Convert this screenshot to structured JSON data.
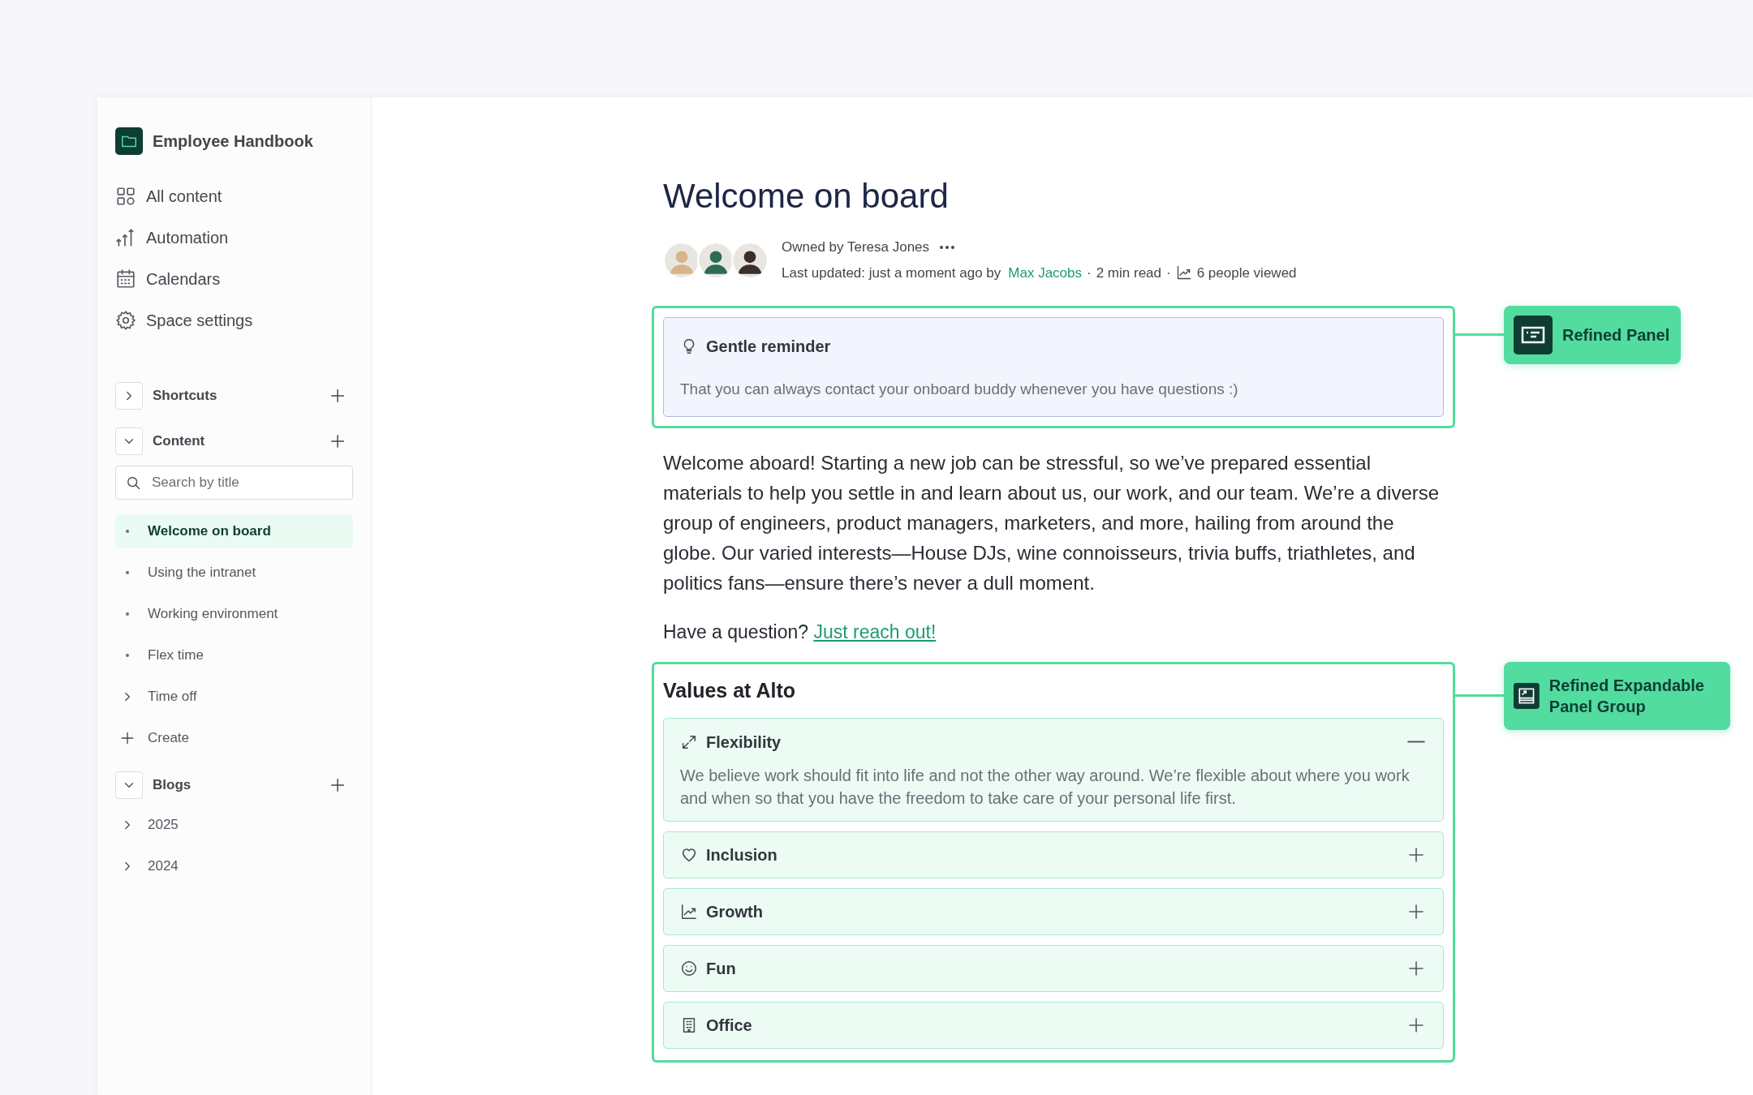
{
  "sidebar": {
    "space_title": "Employee Handbook",
    "nav": [
      {
        "label": "All content"
      },
      {
        "label": "Automation"
      },
      {
        "label": "Calendars"
      },
      {
        "label": "Space settings"
      }
    ],
    "sections": [
      {
        "label": "Shortcuts",
        "expanded": false
      },
      {
        "label": "Content",
        "expanded": true,
        "search": {
          "placeholder": "Search by title"
        },
        "items": [
          {
            "kind": "page",
            "label": "Welcome on board",
            "selected": true
          },
          {
            "kind": "page",
            "label": "Using the intranet",
            "selected": false
          },
          {
            "kind": "page",
            "label": "Working environment",
            "selected": false
          },
          {
            "kind": "page",
            "label": "Flex time",
            "selected": false
          },
          {
            "kind": "folder",
            "label": "Time off",
            "selected": false
          },
          {
            "kind": "create",
            "label": "Create",
            "selected": false
          }
        ]
      },
      {
        "label": "Blogs",
        "expanded": true,
        "items": [
          {
            "kind": "folder",
            "label": "2025",
            "selected": false
          },
          {
            "kind": "folder",
            "label": "2024",
            "selected": false
          }
        ]
      }
    ]
  },
  "page": {
    "title": "Welcome on board",
    "owner": "Owned by Teresa Jones",
    "meta": [
      {
        "kind": "text",
        "text": "Last updated: just a moment ago by"
      },
      {
        "kind": "link",
        "text": "Max Jacobs"
      },
      {
        "kind": "sep",
        "text": "·"
      },
      {
        "kind": "text",
        "text": "2 min read"
      },
      {
        "kind": "sep",
        "text": "·"
      },
      {
        "kind": "views",
        "text": "6 people viewed"
      }
    ],
    "reminder_panel": {
      "title": "Gentle reminder",
      "body": "That you can always contact your onboard buddy whenever you have questions :)",
      "annotation": "Refined Panel"
    },
    "intro": "Welcome aboard! Starting a new job can be stressful, so we’ve prepared essential materials to help you settle in and learn about us, our work, and our team. We’re a diverse group of engineers, product managers, marketers, and more, hailing from around the globe. Our varied interests—House DJs, wine connoisseurs, trivia buffs, triathletes, and politics fans—ensure there’s never a dull moment.",
    "question": {
      "text": "Have a question?",
      "link": "Just reach out!"
    },
    "values_group": {
      "title": "Values at Alto",
      "annotation": "Refined Expandable Panel Group",
      "panels": [
        {
          "title": "Flexibility",
          "expanded": true,
          "body": "We believe work should fit into life and not the other way around. We’re flexible about where you work and when so that you have the freedom to take care of your personal life first."
        },
        {
          "title": "Inclusion",
          "expanded": false
        },
        {
          "title": "Growth",
          "expanded": false
        },
        {
          "title": "Fun",
          "expanded": false
        },
        {
          "title": "Office",
          "expanded": false
        }
      ]
    }
  }
}
